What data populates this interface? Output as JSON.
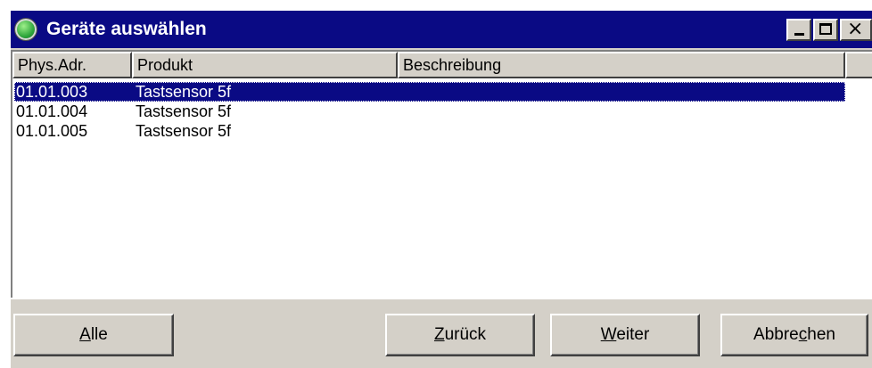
{
  "window": {
    "title": "Geräte auswählen",
    "controls": {
      "minimize": "minimize",
      "maximize": "maximize",
      "close": "×"
    }
  },
  "table": {
    "columns": [
      "Phys.Adr.",
      "Produkt",
      "Beschreibung"
    ],
    "rows": [
      {
        "phys": "01.01.003",
        "produkt": "Tastsensor 5f",
        "beschreibung": "",
        "selected": true
      },
      {
        "phys": "01.01.004",
        "produkt": "Tastsensor 5f",
        "beschreibung": "",
        "selected": false
      },
      {
        "phys": "01.01.005",
        "produkt": "Tastsensor 5f",
        "beschreibung": "",
        "selected": false
      }
    ]
  },
  "buttons": {
    "alle": {
      "pre": "",
      "accel": "A",
      "post": "lle"
    },
    "zurueck": {
      "pre": "",
      "accel": "Z",
      "post": "urück"
    },
    "weiter": {
      "pre": "",
      "accel": "W",
      "post": "eiter"
    },
    "abbrechen": {
      "pre": "Abbre",
      "accel": "c",
      "post": "hen"
    }
  },
  "colors": {
    "titlebar": "#0a0a84",
    "selection": "#0a0a84",
    "face": "#d4d0c8"
  }
}
